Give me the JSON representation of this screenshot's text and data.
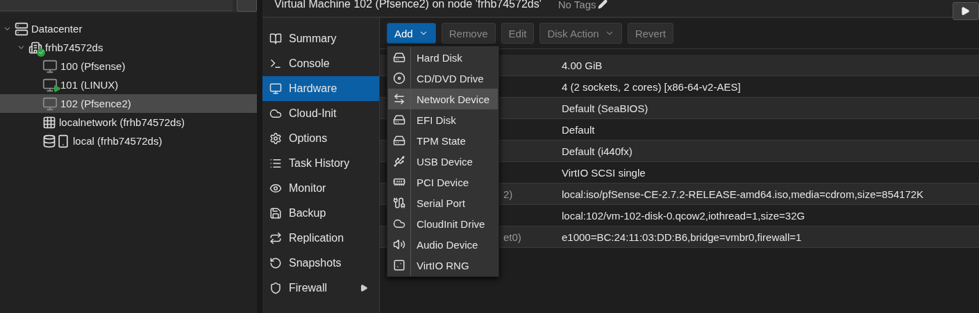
{
  "tree": [
    {
      "label": "Datacenter",
      "kind": "datacenter",
      "expanded": true,
      "selected": false,
      "children": [
        {
          "label": "frhb74572ds",
          "kind": "node",
          "expanded": true,
          "online": true,
          "selected": false,
          "children": [
            {
              "label": "100 (Pfsense)",
              "kind": "vm",
              "running": false,
              "selected": false
            },
            {
              "label": "101 (LINUX)",
              "kind": "vm",
              "running": true,
              "selected": false
            },
            {
              "label": "102 (Pfsence2)",
              "kind": "vm",
              "running": false,
              "selected": true
            },
            {
              "label": "localnetwork (frhb74572ds)",
              "kind": "network",
              "selected": false
            },
            {
              "label": "local (frhb74572ds)",
              "kind": "storage",
              "selected": false
            }
          ]
        }
      ]
    }
  ],
  "header": {
    "title": "Virtual Machine 102 (Pfsence2) on node 'frhb74572ds'",
    "tags": "No Tags"
  },
  "nav": [
    {
      "label": "Summary",
      "kind": "summary",
      "selected": false,
      "submenu": false
    },
    {
      "label": "Console",
      "kind": "console",
      "selected": false,
      "submenu": false
    },
    {
      "label": "Hardware",
      "kind": "hardware",
      "selected": true,
      "submenu": false
    },
    {
      "label": "Cloud-Init",
      "kind": "cloud",
      "selected": false,
      "submenu": false
    },
    {
      "label": "Options",
      "kind": "options",
      "selected": false,
      "submenu": false
    },
    {
      "label": "Task History",
      "kind": "tasks",
      "selected": false,
      "submenu": false
    },
    {
      "label": "Monitor",
      "kind": "monitor",
      "selected": false,
      "submenu": false
    },
    {
      "label": "Backup",
      "kind": "backup",
      "selected": false,
      "submenu": false
    },
    {
      "label": "Replication",
      "kind": "replication",
      "selected": false,
      "submenu": false
    },
    {
      "label": "Snapshots",
      "kind": "snapshots",
      "selected": false,
      "submenu": false
    },
    {
      "label": "Firewall",
      "kind": "firewall",
      "selected": false,
      "submenu": true
    }
  ],
  "toolbar": [
    {
      "label": "Add",
      "disabled": false,
      "primary": true,
      "dropdown": true
    },
    {
      "label": "Remove",
      "disabled": true,
      "primary": false,
      "dropdown": false
    },
    {
      "label": "Edit",
      "disabled": true,
      "primary": false,
      "dropdown": false
    },
    {
      "label": "Disk Action",
      "disabled": true,
      "primary": false,
      "dropdown": true
    },
    {
      "label": "Revert",
      "disabled": true,
      "primary": false,
      "dropdown": false
    }
  ],
  "add_menu": [
    {
      "label": "Hard Disk",
      "kind": "disk",
      "selected": false
    },
    {
      "label": "CD/DVD Drive",
      "kind": "cdrom",
      "selected": false
    },
    {
      "label": "Network Device",
      "kind": "network",
      "selected": true
    },
    {
      "label": "EFI Disk",
      "kind": "disk",
      "selected": false
    },
    {
      "label": "TPM State",
      "kind": "disk",
      "selected": false
    },
    {
      "label": "USB Device",
      "kind": "usb",
      "selected": false
    },
    {
      "label": "PCI Device",
      "kind": "pci",
      "selected": false
    },
    {
      "label": "Serial Port",
      "kind": "serial",
      "selected": false
    },
    {
      "label": "CloudInit Drive",
      "kind": "cloud",
      "selected": false
    },
    {
      "label": "Audio Device",
      "kind": "audio",
      "selected": false
    },
    {
      "label": "VirtIO RNG",
      "kind": "rng",
      "selected": false
    }
  ],
  "rows": [
    {
      "value": "4.00 GiB"
    },
    {
      "value": "4 (2 sockets, 2 cores) [x86-64-v2-AES]"
    },
    {
      "value": "Default (SeaBIOS)"
    },
    {
      "value": "Default"
    },
    {
      "value": "Default (i440fx)"
    },
    {
      "value": "VirtIO SCSI single"
    },
    {
      "key": "2)",
      "value": "local:iso/pfSense-CE-2.7.2-RELEASE-amd64.iso,media=cdrom,size=854172K"
    },
    {
      "value": "local:102/vm-102-disk-0.qcow2,iothread=1,size=32G"
    },
    {
      "key": "et0)",
      "value": "e1000=BC:24:11:03:DD:B6,bridge=vmbr0,firewall=1"
    }
  ]
}
